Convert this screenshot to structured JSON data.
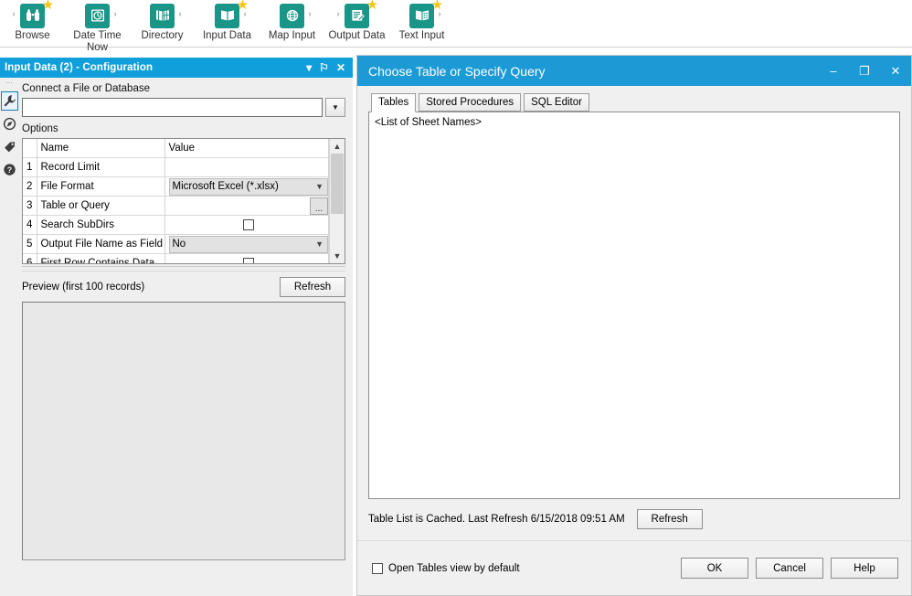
{
  "toolbar": {
    "tools": [
      {
        "label": "Browse",
        "icon": "binoculars-icon",
        "star": true,
        "arrow_left": true,
        "arrow_right": false
      },
      {
        "label": "Date Time\nNow",
        "icon": "clock-icon",
        "star": false,
        "arrow_left": false,
        "arrow_right": true
      },
      {
        "label": "Directory",
        "icon": "book-window-icon",
        "star": false,
        "arrow_left": false,
        "arrow_right": true
      },
      {
        "label": "Input Data",
        "icon": "open-book-icon",
        "star": true,
        "arrow_left": false,
        "arrow_right": true
      },
      {
        "label": "Map Input",
        "icon": "globe-icon",
        "star": false,
        "arrow_left": false,
        "arrow_right": true
      },
      {
        "label": "Output Data",
        "icon": "document-pencil-icon",
        "star": true,
        "arrow_left": true,
        "arrow_right": false
      },
      {
        "label": "Text Input",
        "icon": "book-text-icon",
        "star": true,
        "arrow_left": false,
        "arrow_right": true
      }
    ]
  },
  "config_panel": {
    "title": "Input Data (2) - Configuration",
    "titlebar_buttons": {
      "menu": "▾",
      "pin": "⚐",
      "close": "✕"
    },
    "rail_icons": [
      "wrench-icon",
      "compass-icon",
      "tag-icon",
      "help-icon"
    ],
    "connect_label": "Connect a File or Database",
    "connect_value": "",
    "connect_placeholder": "",
    "options_label": "Options",
    "grid": {
      "headers": [
        "",
        "Name",
        "Value"
      ],
      "rows": [
        {
          "num": "1",
          "name": "Record Limit",
          "value": "",
          "type": "text"
        },
        {
          "num": "2",
          "name": "File Format",
          "value": "Microsoft Excel (*.xlsx)",
          "type": "combo"
        },
        {
          "num": "3",
          "name": "Table or Query",
          "value": "",
          "type": "text-ellipsis",
          "ellipsis": "..."
        },
        {
          "num": "4",
          "name": "Search SubDirs",
          "value": "",
          "type": "checkbox",
          "checked": false
        },
        {
          "num": "5",
          "name": "Output File Name as Field",
          "value": "No",
          "type": "combo"
        },
        {
          "num": "6",
          "name": "First Row Contains Data",
          "value": "",
          "type": "checkbox",
          "checked": false
        }
      ]
    },
    "preview_label": "Preview (first 100 records)",
    "preview_refresh_label": "Refresh"
  },
  "dialog": {
    "title": "Choose Table or Specify Query",
    "window_buttons": {
      "minimize": "–",
      "maximize": "❐",
      "close": "✕"
    },
    "tabs": [
      {
        "label": "Tables",
        "active": true
      },
      {
        "label": "Stored Procedures",
        "active": false
      },
      {
        "label": "SQL Editor",
        "active": false
      }
    ],
    "list_placeholder": "<List of Sheet Names>",
    "cache_text": "Table List is Cached.  Last Refresh 6/15/2018 09:51 AM",
    "cache_refresh_label": "Refresh",
    "open_tables_label": "Open Tables view by default",
    "open_tables_checked": false,
    "buttons": {
      "ok": "OK",
      "cancel": "Cancel",
      "help": "Help"
    }
  },
  "colors": {
    "accent_blue": "#1b9ad6",
    "panel_blue": "#109fda",
    "tool_teal": "#1a9688",
    "star_yellow": "#f5c518",
    "panel_bg": "#efefef",
    "dialog_bg": "#f0f0f0"
  }
}
